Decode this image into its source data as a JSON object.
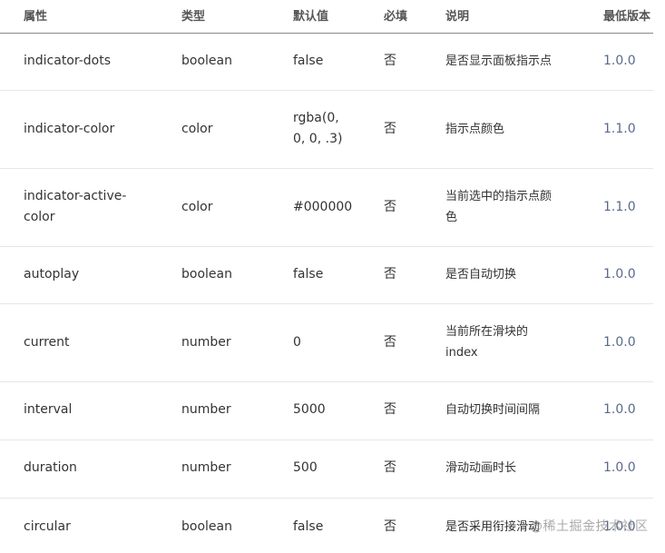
{
  "headers": [
    "属性",
    "类型",
    "默认值",
    "必填",
    "说明",
    "最低版本"
  ],
  "rows": [
    {
      "attr": "indicator-dots",
      "type": "boolean",
      "default": "false",
      "required": "否",
      "desc": "是否显示面板指示点",
      "version": "1.0.0"
    },
    {
      "attr": "indicator-color",
      "type": "color",
      "default": "rgba(0,\n0, 0, .3)",
      "required": "否",
      "desc": "指示点颜色",
      "version": "1.1.0"
    },
    {
      "attr": "indicator-active-\ncolor",
      "type": "color",
      "default": "#000000",
      "required": "否",
      "desc": "当前选中的指示点颜\n色",
      "version": "1.1.0"
    },
    {
      "attr": "autoplay",
      "type": "boolean",
      "default": "false",
      "required": "否",
      "desc": "是否自动切换",
      "version": "1.0.0"
    },
    {
      "attr": "current",
      "type": "number",
      "default": "0",
      "required": "否",
      "desc": "当前所在滑块的\nindex",
      "version": "1.0.0"
    },
    {
      "attr": "interval",
      "type": "number",
      "default": "5000",
      "required": "否",
      "desc": "自动切换时间间隔",
      "version": "1.0.0"
    },
    {
      "attr": "duration",
      "type": "number",
      "default": "500",
      "required": "否",
      "desc": "滑动动画时长",
      "version": "1.0.0"
    },
    {
      "attr": "circular",
      "type": "boolean",
      "default": "false",
      "required": "否",
      "desc": "是否采用衔接滑动",
      "version": "1.0.0"
    }
  ],
  "watermark": "@稀土掘金技术社区"
}
